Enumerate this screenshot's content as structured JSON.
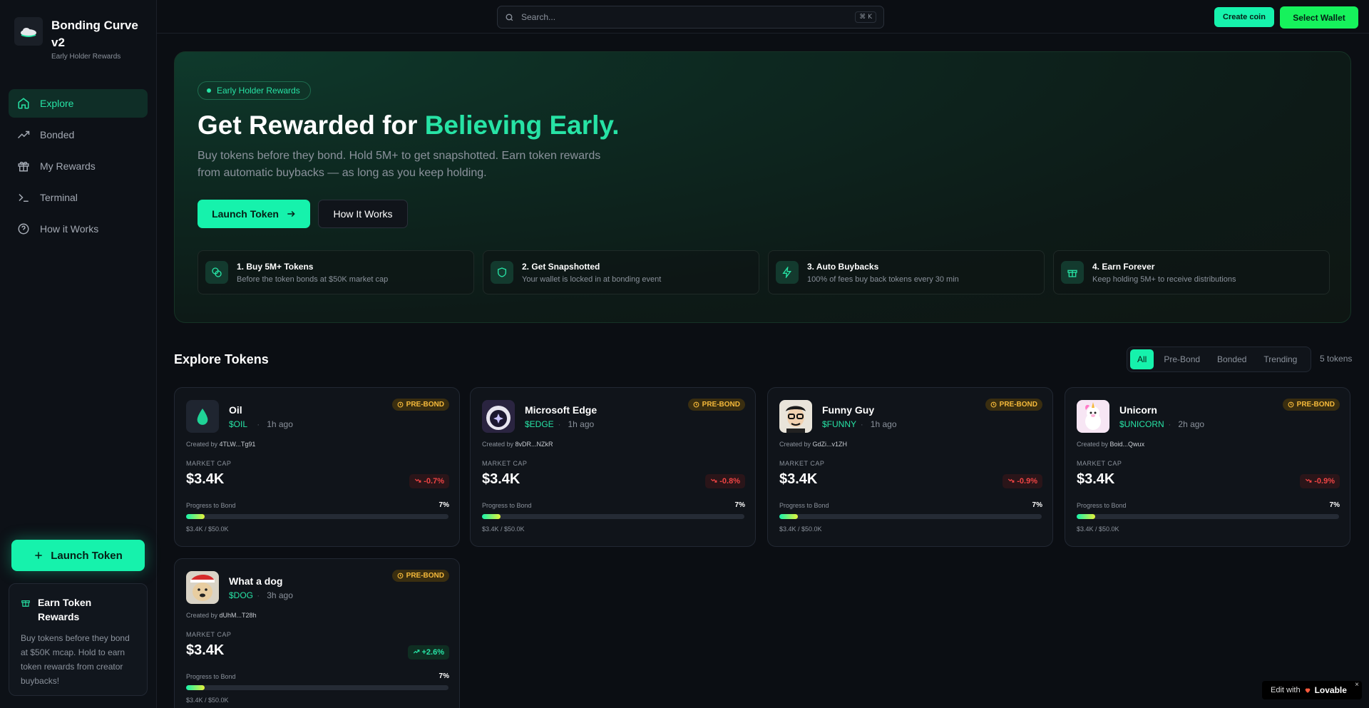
{
  "brand": {
    "title": "Bonding Curve v2",
    "subtitle": "Early Holder Rewards"
  },
  "nav": [
    {
      "label": "Explore",
      "icon": "home-icon",
      "active": true
    },
    {
      "label": "Bonded",
      "icon": "trending-up-icon"
    },
    {
      "label": "My Rewards",
      "icon": "gift-icon"
    },
    {
      "label": "Terminal",
      "icon": "terminal-icon"
    },
    {
      "label": "How it Works",
      "icon": "help-circle-icon"
    }
  ],
  "sidebar": {
    "launch_label": "Launch Token",
    "earn_title": "Earn Token Rewards",
    "earn_text": "Buy tokens before they bond at $50K mcap. Hold to earn token rewards from creator buybacks!"
  },
  "topbar": {
    "search_placeholder": "Search...",
    "search_shortcut": "⌘ K",
    "create_label": "Create coin",
    "wallet_label": "Select Wallet"
  },
  "hero": {
    "pill": "Early Holder Rewards",
    "title_plain": "Get Rewarded for ",
    "title_accent": "Believing Early.",
    "description": "Buy tokens before they bond. Hold 5M+ to get snapshotted. Earn token rewards from automatic buybacks — as long as you keep holding.",
    "launch_label": "Launch Token",
    "how_label": "How It Works",
    "steps": [
      {
        "title": "1. Buy 5M+ Tokens",
        "desc": "Before the token bonds at $50K market cap",
        "icon": "coins-icon"
      },
      {
        "title": "2. Get Snapshotted",
        "desc": "Your wallet is locked in at bonding event",
        "icon": "shield-icon"
      },
      {
        "title": "3. Auto Buybacks",
        "desc": "100% of fees buy back tokens every 30 min",
        "icon": "lightning-icon"
      },
      {
        "title": "4. Earn Forever",
        "desc": "Keep holding 5M+ to receive distributions",
        "icon": "gift-icon"
      }
    ]
  },
  "explore": {
    "title": "Explore Tokens",
    "filters": [
      "All",
      "Pre-Bond",
      "Bonded",
      "Trending"
    ],
    "active_filter": "All",
    "count": "5 tokens"
  },
  "labels": {
    "market_cap": "MARKET CAP",
    "progress": "Progress to Bond",
    "created_by": "Created by",
    "badge": "PRE-BOND"
  },
  "tokens": [
    {
      "name": "Oil",
      "symbol": "$OIL",
      "age": "1h ago",
      "creator": "4TLW...Tg91",
      "market_cap": "$3.4K",
      "change": "-0.7%",
      "direction": "down",
      "progress": "7%",
      "progress_value": 0.07,
      "progress_text": "$3.4K / $50.0K",
      "avatar": "oil-drop-icon"
    },
    {
      "name": "Microsoft Edge",
      "symbol": "$EDGE",
      "age": "1h ago",
      "creator": "8vDR...NZkR",
      "market_cap": "$3.4K",
      "change": "-0.8%",
      "direction": "down",
      "progress": "7%",
      "progress_value": 0.07,
      "progress_text": "$3.4K / $50.0K",
      "avatar": "edge-avatar"
    },
    {
      "name": "Funny Guy",
      "symbol": "$FUNNY",
      "age": "1h ago",
      "creator": "GdZi...v1ZH",
      "market_cap": "$3.4K",
      "change": "-0.9%",
      "direction": "down",
      "progress": "7%",
      "progress_value": 0.07,
      "progress_text": "$3.4K / $50.0K",
      "avatar": "funny-guy-avatar"
    },
    {
      "name": "Unicorn",
      "symbol": "$UNICORN",
      "age": "2h ago",
      "creator": "Boid...Qwux",
      "market_cap": "$3.4K",
      "change": "-0.9%",
      "direction": "down",
      "progress": "7%",
      "progress_value": 0.07,
      "progress_text": "$3.4K / $50.0K",
      "avatar": "unicorn-avatar"
    },
    {
      "name": "What a dog",
      "symbol": "$DOG",
      "age": "3h ago",
      "creator": "dUhM...T28h",
      "market_cap": "$3.4K",
      "change": "+2.6%",
      "direction": "up",
      "progress": "7%",
      "progress_value": 0.07,
      "progress_text": "$3.4K / $50.0K",
      "avatar": "dog-avatar"
    }
  ],
  "lovable": {
    "prefix": "Edit with",
    "brand": "Lovable",
    "close": "×"
  },
  "colors": {
    "accent": "#16f2ac",
    "background": "#0b0e13",
    "down": "#ef4444",
    "badge": "#f5b93a"
  }
}
